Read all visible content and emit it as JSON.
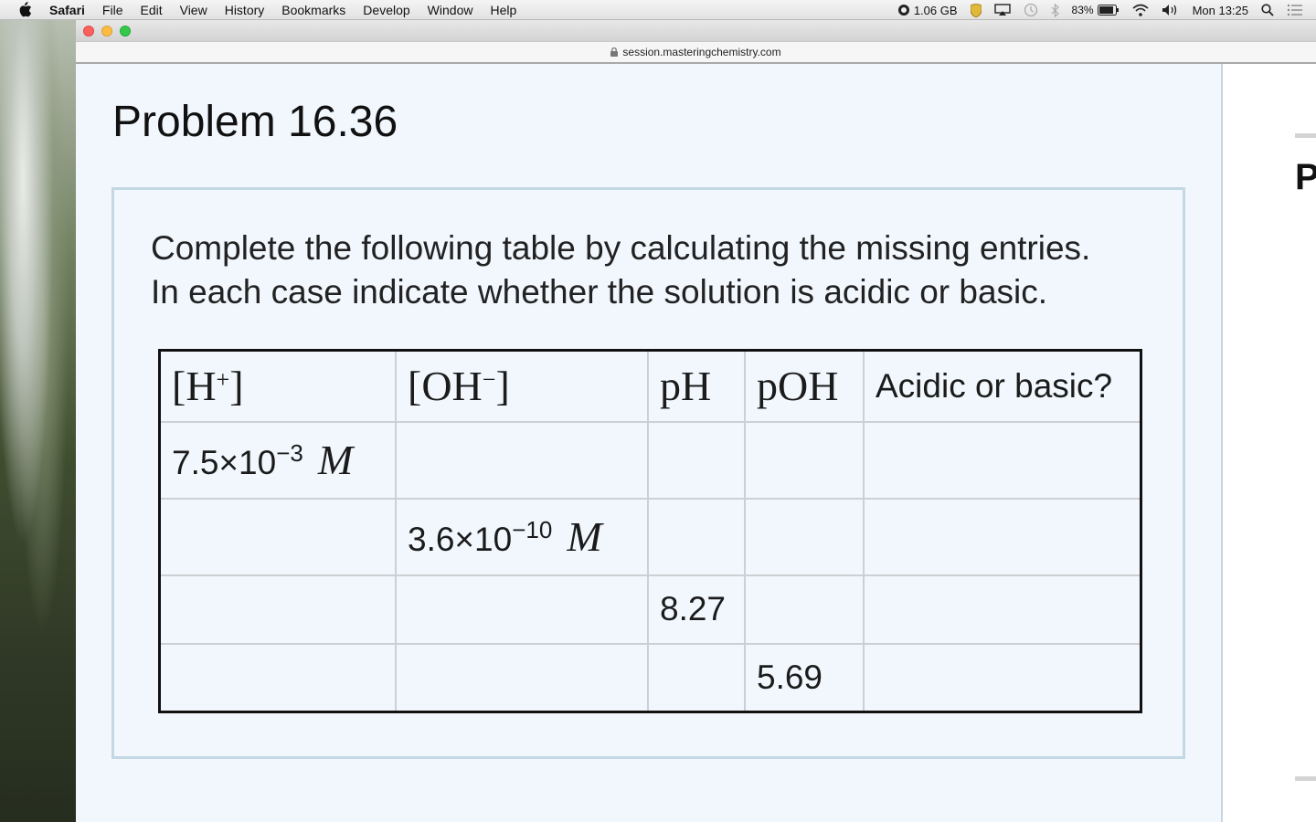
{
  "menubar": {
    "app_name": "Safari",
    "items": [
      "File",
      "Edit",
      "View",
      "History",
      "Bookmarks",
      "Develop",
      "Window",
      "Help"
    ],
    "memory": "1.06 GB",
    "battery": "83%",
    "clock": "Mon 13:25"
  },
  "browser": {
    "url": "session.masteringchemistry.com"
  },
  "problem": {
    "title": "Problem 16.36",
    "prompt_line1": "Complete the following table by calculating the missing entries.",
    "prompt_line2": "In each case indicate whether the solution is acidic or basic."
  },
  "table": {
    "headers": {
      "h": "[H",
      "h_sup": "+",
      "h_close": "]",
      "oh": "[OH",
      "oh_sup": "−",
      "oh_close": "]",
      "ph": "pH",
      "poh": "pOH",
      "acidic": "Acidic or basic?"
    },
    "rows": [
      {
        "h_mantissa": "7.5×10",
        "h_exp": "−3",
        "h_unit": "M"
      },
      {
        "oh_mantissa": "3.6×10",
        "oh_exp": "−10",
        "oh_unit": "M"
      },
      {
        "ph": "8.27"
      },
      {
        "poh": "5.69"
      }
    ]
  },
  "side_panel": {
    "letter": "P"
  },
  "colors": {
    "page_bg": "#f1f7fd",
    "box_border": "#c4d7e4",
    "table_border": "#111111"
  }
}
